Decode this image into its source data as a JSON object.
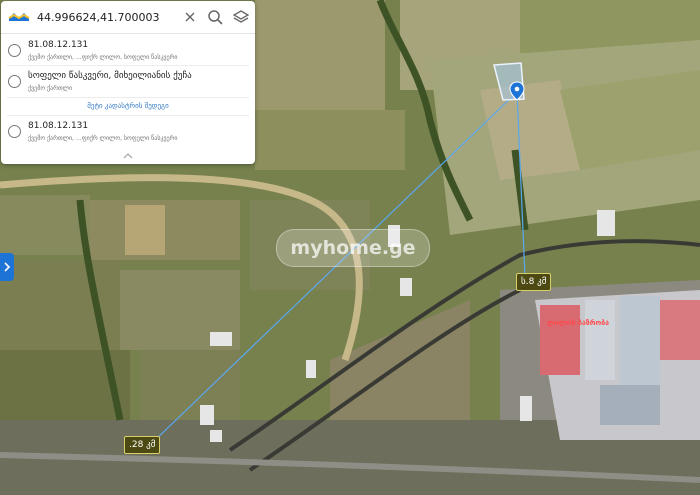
{
  "search": {
    "value": "44.996624,41.700003",
    "placeholder": ""
  },
  "results": [
    {
      "title": "81.08.12.131",
      "subtitle": "ქვემო ქართლი, ...ფიქრ ლილო, სოფელი წასკვერი"
    },
    {
      "title": "სოფელი წასკვერი, მიხეილიანის ქუჩა",
      "subtitle": "ქვემო ქართლი"
    }
  ],
  "more_label": "მეტი კადასტრის შედეგი",
  "results_more": [
    {
      "title": "81.08.12.131",
      "subtitle": "ქვემო ქართლი, ...ფიქრ ლილო, სოფელი წასკვერი"
    }
  ],
  "map": {
    "distance_labels": [
      "ს.8 კმ",
      ".28 კმ"
    ],
    "market_label": "ლილოს ბაზრობა",
    "watermark": "myhome.ge"
  },
  "icons": {
    "logo": "georgian-flag-logo",
    "clear": "close-icon",
    "search": "search-icon",
    "layers": "layers-icon",
    "collapse": "chevron-up-icon",
    "side": "chevron-right-icon"
  },
  "colors": {
    "accent": "#1e73d6",
    "market": "#ff4a4a",
    "parcel": "#a6c8ec"
  }
}
